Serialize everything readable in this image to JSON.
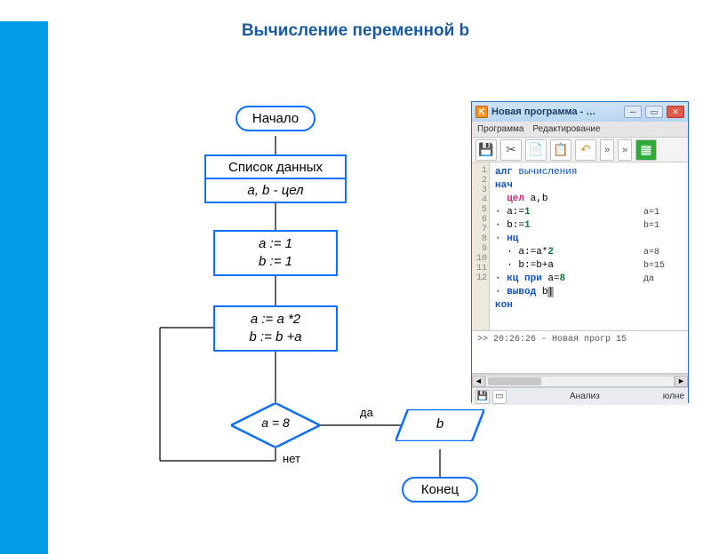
{
  "title": "Вычисление переменной b",
  "flow": {
    "start": "Начало",
    "data_header": "Список данных",
    "data_decl": "a, b - цел",
    "init": [
      "a := 1",
      "b := 1"
    ],
    "loop": [
      "a := a *2",
      "b := b +a"
    ],
    "cond": "a = 8",
    "yes": "да",
    "no": "нет",
    "output": "b",
    "end": "Конец"
  },
  "app": {
    "title": "Новая программа - …",
    "menu": [
      "Программа",
      "Редактирование"
    ],
    "toolbar": {
      "save": "save-icon",
      "cut": "scissors-icon",
      "copy": "copy-icon",
      "paste": "paste-icon",
      "undo": "undo-icon",
      "more1": "»",
      "more2": "»",
      "grid": "grid-icon"
    },
    "gutter": [
      "1",
      "2",
      "3",
      "4",
      "5",
      "6",
      "7",
      "8",
      "9",
      "10",
      "11",
      "12"
    ],
    "code": "алг вычисления\nнач\n  цел a,b\n· a:=1\n· b:=1\n· нц\n  · a:=a*2\n  · b:=b+a\n· кц при a=8\n· вывод b|\nкон\n",
    "trace": "\n\n\na=1\nb=1\n\na=8\nb=15\nда\n",
    "console": ">> 20:26:26 - Новая прогр\n15",
    "status_left": [
      "save-icon",
      "page-icon"
    ],
    "status_mid": "Анализ",
    "status_right": "юлне"
  }
}
